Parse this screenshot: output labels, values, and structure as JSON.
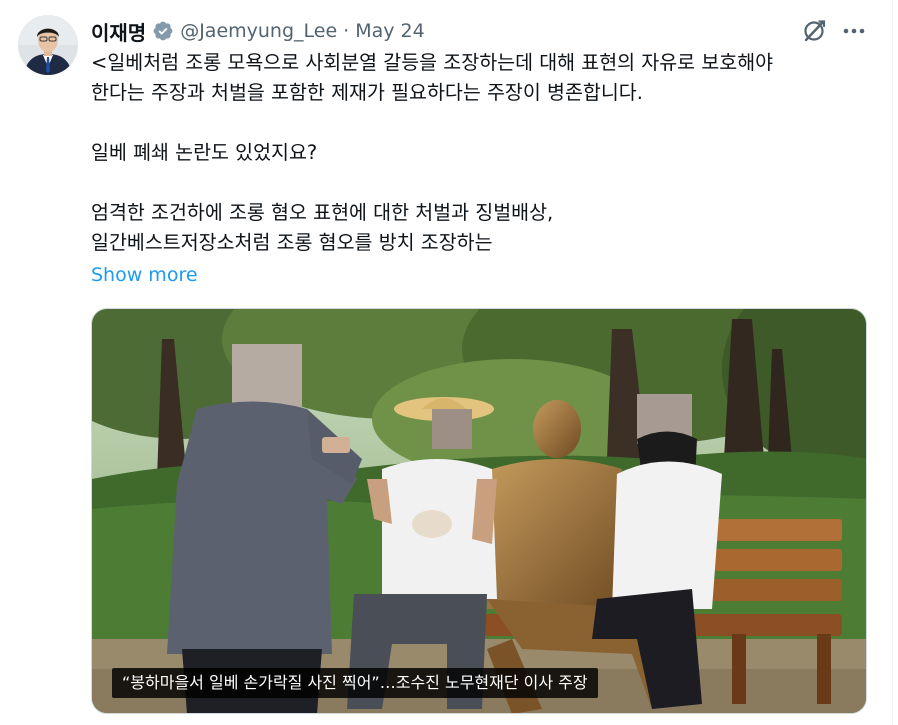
{
  "tweet": {
    "author_name": "이재명",
    "handle": "@Jaemyung_Lee",
    "separator": "·",
    "date": "May 24",
    "text_lines": [
      "<일베처럼 조롱 모욕으로 사회분열 갈등을 조장하는데 대해 표현의 자유로 보호해야",
      "한다는 주장과 처벌을 포함한 제재가 필요하다는 주장이 병존합니다.",
      "",
      "일베 폐쇄 논란도 있었지요?",
      "",
      "엄격한 조건하에 조롱 혐오 표현에 대한 처벌과 징벌배상,",
      "일간베스트저장소처럼 조롱 혐오를 방치 조장하는"
    ],
    "show_more": "Show more",
    "media_caption": "“봉하마을서 일베 손가락질 사진 찍어”…조수진 노무현재단 이사 주장"
  },
  "icons": {
    "verified": "verified-badge-icon",
    "grok": "grok-icon",
    "more": "more-options-icon"
  },
  "colors": {
    "link": "#1d9bf0",
    "verified": "#829aab",
    "secondary_text": "#536471"
  }
}
